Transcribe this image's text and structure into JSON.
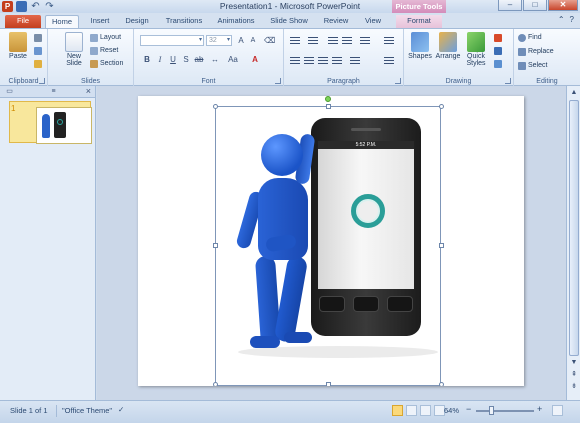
{
  "window": {
    "title": "Presentation1 - Microsoft PowerPoint",
    "context_tab": "Picture Tools",
    "minimize": "–",
    "maximize": "□",
    "close": "✕"
  },
  "tabs": [
    {
      "label": "File"
    },
    {
      "label": "Home"
    },
    {
      "label": "Insert"
    },
    {
      "label": "Design"
    },
    {
      "label": "Transitions"
    },
    {
      "label": "Animations"
    },
    {
      "label": "Slide Show"
    },
    {
      "label": "Review"
    },
    {
      "label": "View"
    },
    {
      "label": "Format"
    }
  ],
  "ribbon": {
    "clipboard": {
      "label": "Clipboard",
      "paste": "Paste"
    },
    "slides": {
      "label": "Slides",
      "new_slide": "New Slide",
      "layout": "Layout",
      "reset": "Reset",
      "section": "Section"
    },
    "font": {
      "label": "Font",
      "font_size": "32"
    },
    "paragraph": {
      "label": "Paragraph"
    },
    "drawing": {
      "label": "Drawing",
      "shapes": "Shapes",
      "arrange": "Arrange",
      "quick_styles": "Quick Styles"
    },
    "editing": {
      "label": "Editing",
      "find": "Find",
      "replace": "Replace",
      "select": "Select"
    }
  },
  "slide_panel": {
    "slide_number": "1"
  },
  "phone_status": "5:52 P.M.",
  "statusbar": {
    "slide_info": "Slide 1 of 1",
    "theme": "\"Office Theme\"",
    "zoom": "64%"
  },
  "colors": {
    "file_tab": "#c33f1f",
    "context_tab": "#d38cba",
    "figure_blue": "#1b54c8",
    "ring_teal": "#2a9e98"
  }
}
